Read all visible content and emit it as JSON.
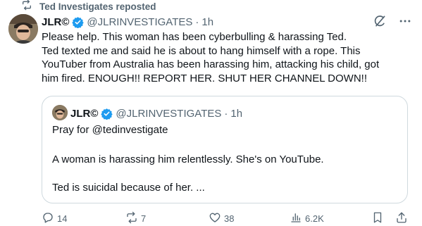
{
  "repost": {
    "text": "Ted Investigates reposted"
  },
  "tweet": {
    "name": "JLR©",
    "handle": "@JLRINVESTIGATES",
    "dot": "·",
    "time": "1h",
    "lines": [
      "Please help. This woman has been cyberbulling & harassing Ted.",
      "Ted texted me and said he is about to hang himself with a rope. This",
      "YouTuber from Australia has been harassing him, attacking his child, got",
      "him fired. ENOUGH!! REPORT HER. SHUT HER CHANNEL DOWN!!"
    ]
  },
  "quote": {
    "name": "JLR©",
    "handle": "@JLRINVESTIGATES",
    "dot": "·",
    "time": "1h",
    "line1": "Pray for @tedinvestigate",
    "line2": "A woman is harassing him relentlessly. She's on YouTube.",
    "line3": "Ted is suicidal because of her. ..."
  },
  "actions": {
    "replies": "14",
    "reposts": "7",
    "likes": "38",
    "views": "6.2K"
  },
  "icons": {
    "repost": "repost-icon",
    "verified": "verified-badge-icon",
    "grok": "grok-icon",
    "more": "more-icon",
    "reply": "reply-icon",
    "like": "heart-icon",
    "views": "views-icon",
    "bookmark": "bookmark-icon",
    "share": "share-icon"
  },
  "colors": {
    "text": "#0f1419",
    "secondary": "#536471",
    "verified": "#1d9bf0",
    "border": "#cfd9de",
    "repost_green": "#00ba7c"
  }
}
